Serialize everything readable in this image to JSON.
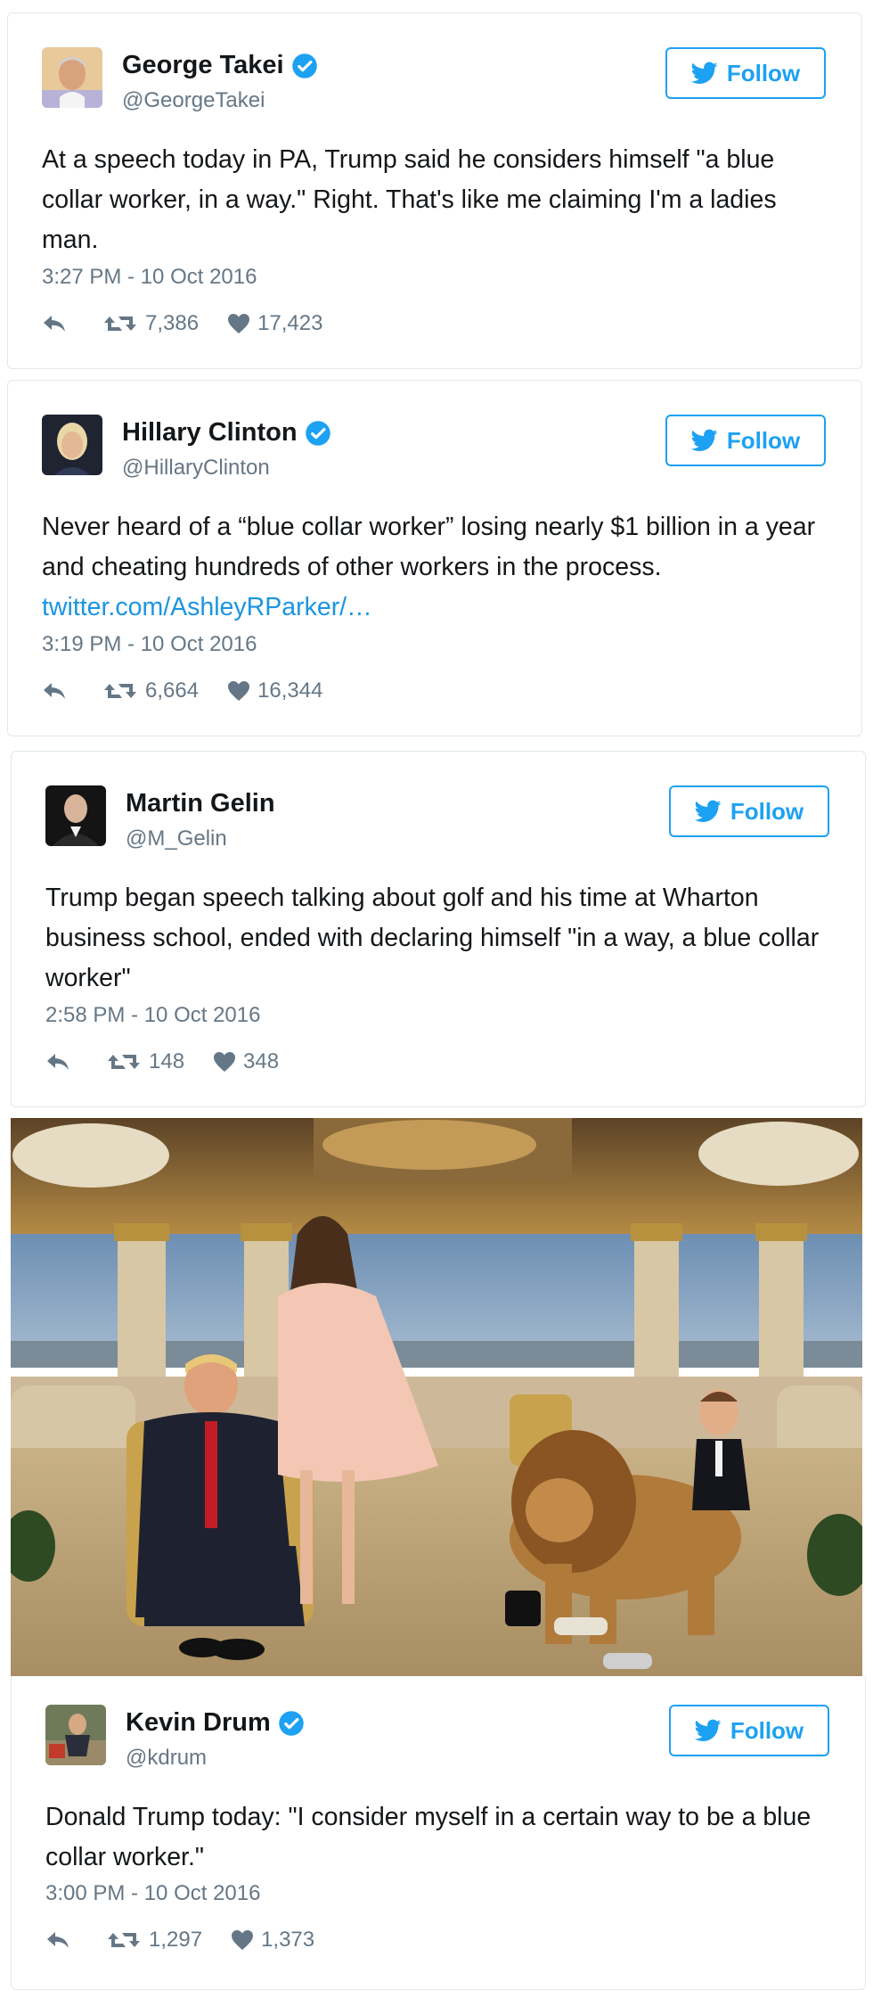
{
  "colors": {
    "twitter_blue": "#1da1f2",
    "link_blue": "#1b95e0",
    "muted": "#657786",
    "text": "#14171a",
    "border": "#e1e8ed"
  },
  "icons": {
    "verified": "verified-badge-icon",
    "bird": "twitter-bird-icon",
    "reply": "reply-icon",
    "retweet": "retweet-icon",
    "like": "heart-icon"
  },
  "tweets": [
    {
      "name": "George Takei",
      "handle": "@GeorgeTakei",
      "verified": true,
      "follow_label": "Follow",
      "text": "At a speech today in PA, Trump said he considers himself \"a blue collar worker, in a way.\" Right. That's like me claiming I'm a ladies man.",
      "link": "",
      "timestamp": "3:27 PM - 10 Oct 2016",
      "retweets": "7,386",
      "likes": "17,423"
    },
    {
      "name": "Hillary Clinton",
      "handle": "@HillaryClinton",
      "verified": true,
      "follow_label": "Follow",
      "text": "Never heard of a “blue collar worker” losing nearly $1 billion in a year and cheating hundreds of other workers in the process.",
      "link": "twitter.com/AshleyRParker/…",
      "timestamp": "3:19 PM - 10 Oct 2016",
      "retweets": "6,664",
      "likes": "16,344"
    },
    {
      "name": "Martin Gelin",
      "handle": "@M_Gelin",
      "verified": false,
      "follow_label": "Follow",
      "text": "Trump began speech talking about golf and his time at Wharton business school, ended with declaring himself \"in a way, a blue collar worker\"",
      "link": "",
      "timestamp": "2:58 PM - 10 Oct 2016",
      "retweets": "148",
      "likes": "348"
    },
    {
      "name": "Kevin Drum",
      "handle": "@kdrum",
      "verified": true,
      "follow_label": "Follow",
      "text": "Donald Trump today: \"I consider myself in a certain way to be a blue collar worker.\"",
      "link": "",
      "timestamp": "3:00 PM - 10 Oct 2016",
      "retweets": "1,297",
      "likes": "1,373"
    }
  ]
}
